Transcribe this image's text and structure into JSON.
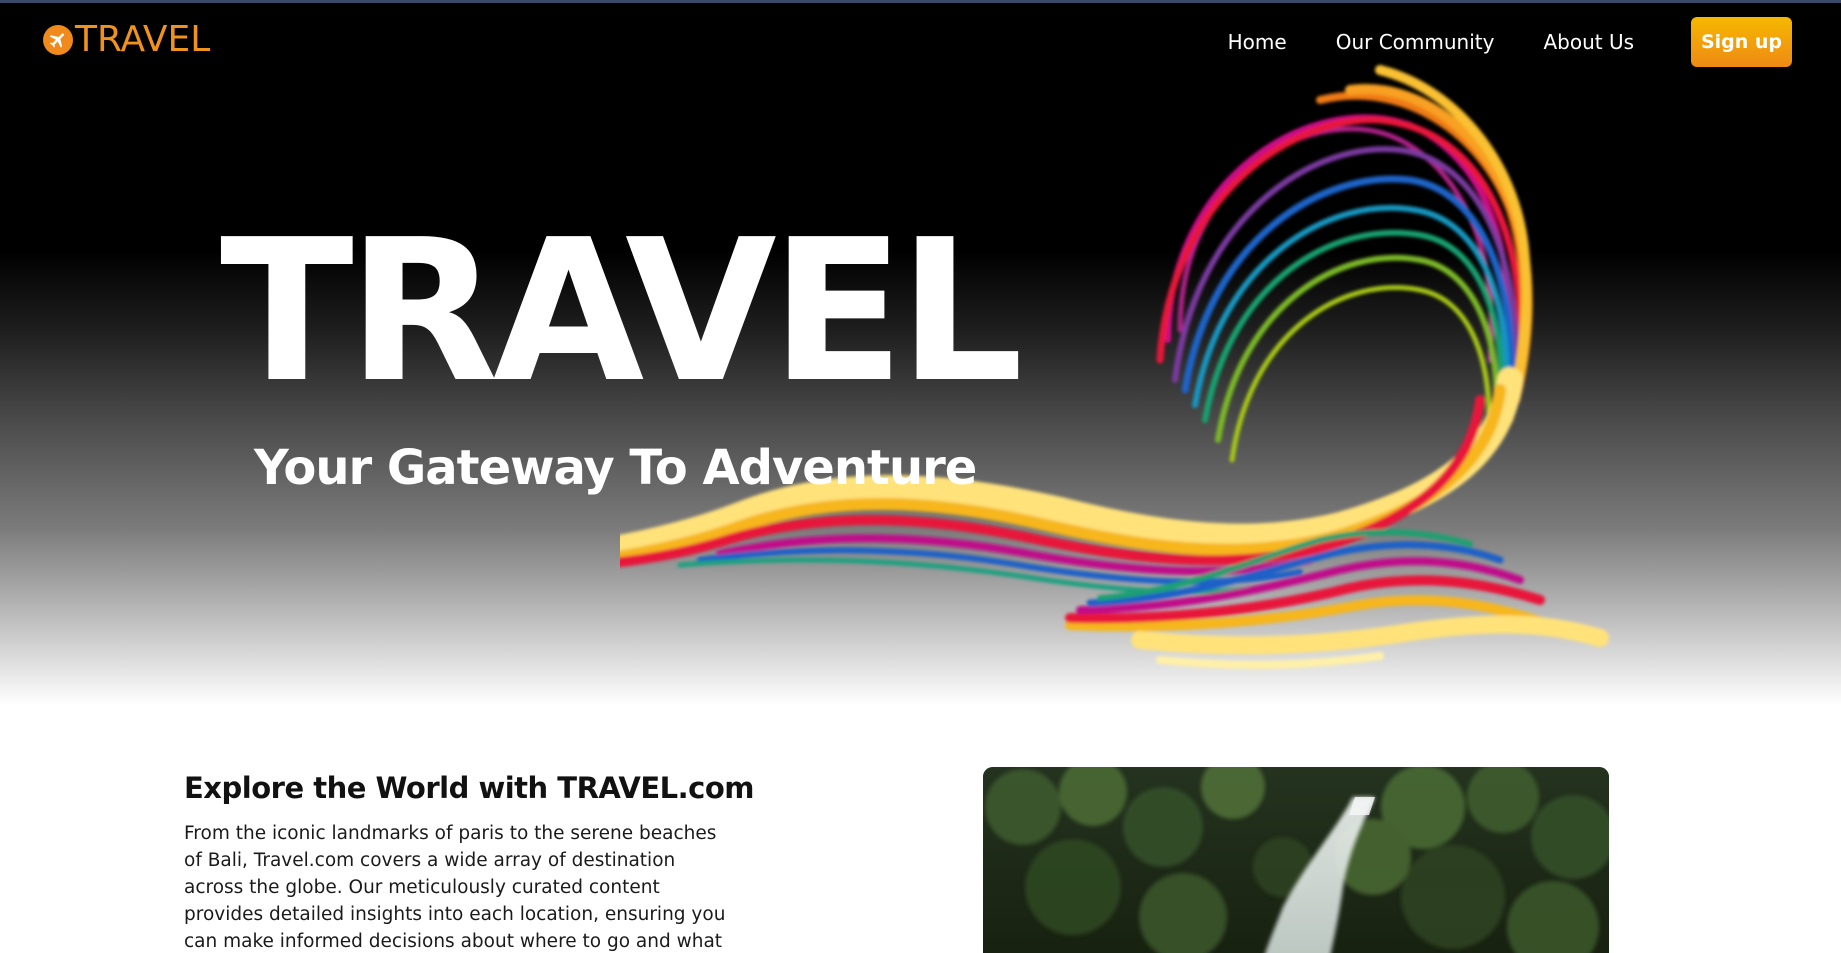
{
  "brand": {
    "logo_text": "TRAVEL",
    "accent_color": "#f0921e",
    "logo_icon": "airplane-icon"
  },
  "nav": {
    "items": [
      {
        "label": "Home"
      },
      {
        "label": "Our Community"
      },
      {
        "label": "About Us"
      }
    ],
    "signup_label": "Sign up",
    "signup_color": "#f2a20c"
  },
  "hero": {
    "title": "TRAVEL",
    "subtitle": "Your Gateway To Adventure",
    "graphic": "rainbow-swoosh"
  },
  "content": {
    "heading": "Explore the World with TRAVEL.com",
    "body": "From the iconic landmarks of paris to the serene beaches of Bali, Travel.com covers a wide array of destination across the globe. Our meticulously curated content provides detailed insights into each location, ensuring you can make informed decisions about where to go and what to see.",
    "image_subject": "waterfall-in-forest-photo"
  }
}
